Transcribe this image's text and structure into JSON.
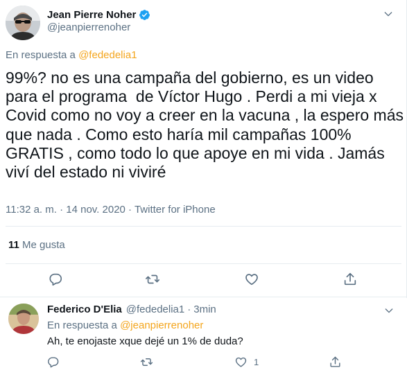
{
  "tweet": {
    "display_name": "Jean Pierre Noher",
    "handle": "@jeanpierrenoher",
    "reply_prefix": "En respuesta a",
    "reply_to": "@fededelia1",
    "text": "99%? no es una campaña del gobierno, es un video para el programa  de Víctor Hugo . Perdi a mi vieja x Covid como no voy a creer en la vacuna , la espero más que nada . Como esto haría mil campañas 100% GRATIS , como todo lo que apoye en mi vida . Jamás viví del estado ni viviré",
    "meta": "11:32 a. m. · 14 nov. 2020 · Twitter for iPhone",
    "likes_count": "11",
    "likes_label": "Me gusta",
    "verified": true
  },
  "reply": {
    "display_name": "Federico D'Elia",
    "handle": "@fededelia1",
    "separator": "·",
    "time": "3min",
    "reply_prefix": "En respuesta a",
    "reply_to": "@jeanpierrenoher",
    "text": "Ah, te enojaste xque dejé un 1% de duda?",
    "like_count": "1"
  },
  "icons": {
    "more": "chevron-down-icon",
    "reply": "comment-icon",
    "retweet": "retweet-icon",
    "like": "heart-icon",
    "share": "share-icon",
    "verified": "verified-badge-icon"
  },
  "colors": {
    "mention": "#f4a51c",
    "verified": "#1da1f2",
    "secondary_text": "#5b7083",
    "divider": "#e6ecf0"
  }
}
